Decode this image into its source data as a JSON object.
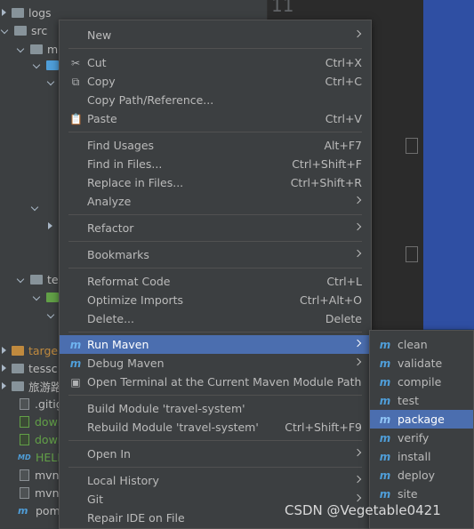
{
  "editor": {
    "line_number": "11"
  },
  "tree": {
    "items": [
      {
        "label": "logs",
        "type": "folder"
      },
      {
        "label": "src",
        "type": "folder"
      },
      {
        "label": "m",
        "type": "folder"
      },
      {
        "label": "te",
        "type": "folder"
      },
      {
        "label": "targe",
        "type": "folder-orange"
      },
      {
        "label": "tessc",
        "type": "folder"
      },
      {
        "label": "旅游路",
        "type": "folder"
      },
      {
        "label": ".gitig",
        "type": "file"
      },
      {
        "label": "dowr",
        "type": "file-green"
      },
      {
        "label": "dowr",
        "type": "file-green"
      },
      {
        "label": "HELP",
        "type": "md"
      },
      {
        "label": "mvnv",
        "type": "file"
      },
      {
        "label": "mvnv",
        "type": "file"
      },
      {
        "label": "pom",
        "type": "maven"
      }
    ]
  },
  "context_menu": {
    "items": [
      {
        "label": "New",
        "shortcut": "",
        "submenu": true,
        "icon": ""
      },
      {
        "label": "Cut",
        "shortcut": "Ctrl+X",
        "submenu": false,
        "icon": "scissors-icon"
      },
      {
        "label": "Copy",
        "shortcut": "Ctrl+C",
        "submenu": false,
        "icon": "copy-icon"
      },
      {
        "label": "Copy Path/Reference...",
        "shortcut": "",
        "submenu": false,
        "icon": ""
      },
      {
        "label": "Paste",
        "shortcut": "Ctrl+V",
        "submenu": false,
        "icon": "paste-icon"
      },
      {
        "label": "Find Usages",
        "shortcut": "Alt+F7",
        "submenu": false,
        "icon": ""
      },
      {
        "label": "Find in Files...",
        "shortcut": "Ctrl+Shift+F",
        "submenu": false,
        "icon": ""
      },
      {
        "label": "Replace in Files...",
        "shortcut": "Ctrl+Shift+R",
        "submenu": false,
        "icon": ""
      },
      {
        "label": "Analyze",
        "shortcut": "",
        "submenu": true,
        "icon": ""
      },
      {
        "label": "Refactor",
        "shortcut": "",
        "submenu": true,
        "icon": ""
      },
      {
        "label": "Bookmarks",
        "shortcut": "",
        "submenu": true,
        "icon": ""
      },
      {
        "label": "Reformat Code",
        "shortcut": "Ctrl+L",
        "submenu": false,
        "icon": ""
      },
      {
        "label": "Optimize Imports",
        "shortcut": "Ctrl+Alt+O",
        "submenu": false,
        "icon": ""
      },
      {
        "label": "Delete...",
        "shortcut": "Delete",
        "submenu": false,
        "icon": ""
      },
      {
        "label": "Run Maven",
        "shortcut": "",
        "submenu": true,
        "icon": "maven-run-icon",
        "selected": true
      },
      {
        "label": "Debug Maven",
        "shortcut": "",
        "submenu": true,
        "icon": "maven-debug-icon"
      },
      {
        "label": "Open Terminal at the Current Maven Module Path",
        "shortcut": "",
        "submenu": false,
        "icon": "terminal-icon"
      },
      {
        "label": "Build Module 'travel-system'",
        "shortcut": "",
        "submenu": false,
        "icon": ""
      },
      {
        "label": "Rebuild Module 'travel-system'",
        "shortcut": "Ctrl+Shift+F9",
        "submenu": false,
        "icon": ""
      },
      {
        "label": "Open In",
        "shortcut": "",
        "submenu": true,
        "icon": ""
      },
      {
        "label": "Local History",
        "shortcut": "",
        "submenu": true,
        "icon": ""
      },
      {
        "label": "Git",
        "shortcut": "",
        "submenu": true,
        "icon": ""
      },
      {
        "label": "Repair IDE on File",
        "shortcut": "",
        "submenu": false,
        "icon": ""
      }
    ]
  },
  "maven_submenu": {
    "items": [
      {
        "label": "clean"
      },
      {
        "label": "validate"
      },
      {
        "label": "compile"
      },
      {
        "label": "test"
      },
      {
        "label": "package",
        "selected": true
      },
      {
        "label": "verify"
      },
      {
        "label": "install"
      },
      {
        "label": "deploy"
      },
      {
        "label": "site"
      }
    ]
  },
  "watermark": "CSDN @Vegetable0421",
  "colors": {
    "selection": "#4b6eaf",
    "menu_bg": "#3c3f41",
    "tree_bg": "#3c3f41",
    "editor_bg": "#2b2b2b",
    "maven_icon": "#4f9ed9"
  }
}
